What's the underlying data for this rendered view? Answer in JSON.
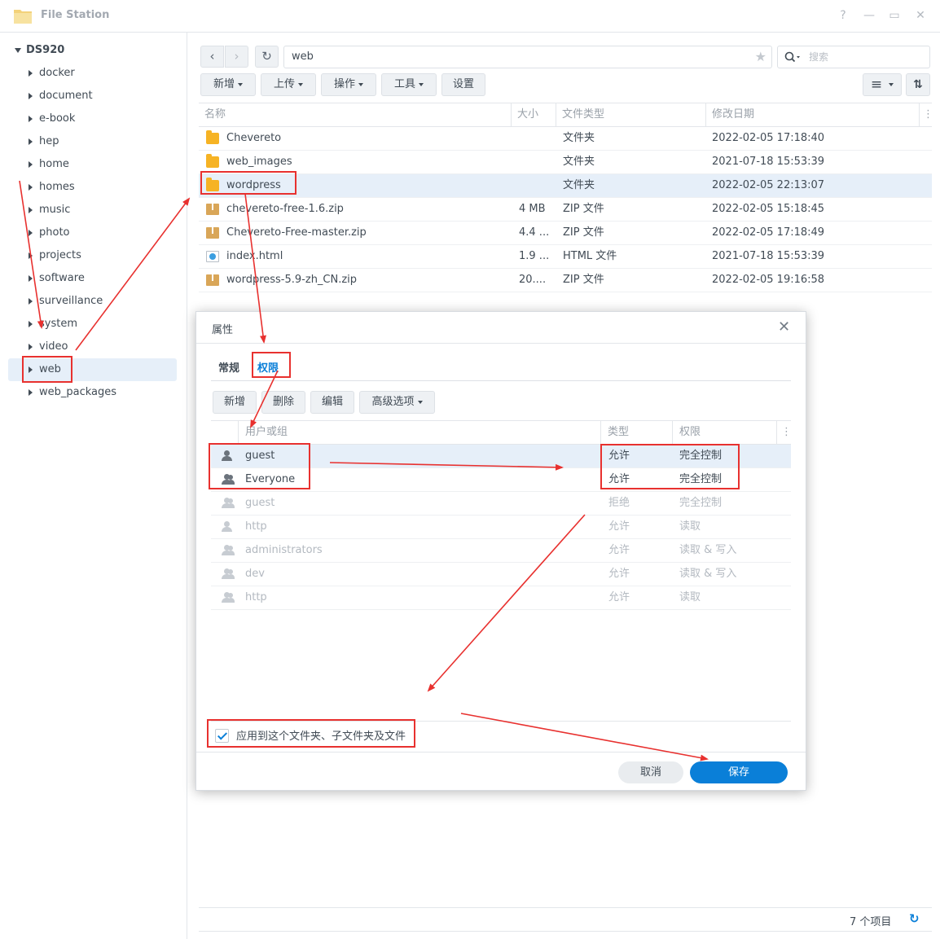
{
  "window": {
    "title": "File Station",
    "help": "?",
    "minimize": "—",
    "maximize": "▭",
    "close": "✕"
  },
  "sidebar": {
    "root": "DS920",
    "items": [
      {
        "label": "docker"
      },
      {
        "label": "document"
      },
      {
        "label": "e-book"
      },
      {
        "label": "hep"
      },
      {
        "label": "home"
      },
      {
        "label": "homes"
      },
      {
        "label": "music"
      },
      {
        "label": "photo"
      },
      {
        "label": "projects"
      },
      {
        "label": "software"
      },
      {
        "label": "surveillance"
      },
      {
        "label": "system"
      },
      {
        "label": "video"
      },
      {
        "label": "web"
      },
      {
        "label": "web_packages"
      }
    ]
  },
  "toolbar": {
    "back": "‹",
    "forward": "›",
    "refresh": "↻",
    "path": "web",
    "star": "★",
    "search_placeholder": "搜索",
    "search_icon": "search-icon",
    "new": "新增",
    "upload": "上传",
    "action": "操作",
    "tools": "工具",
    "settings": "设置",
    "list_view": "≡",
    "sort": "⇅"
  },
  "file_list": {
    "headers": {
      "name": "名称",
      "size": "大小",
      "type": "文件类型",
      "modified": "修改日期"
    },
    "rows": [
      {
        "icon": "folder-icon",
        "name": "Chevereto",
        "size": "",
        "type": "文件夹",
        "modified": "2022-02-05 17:18:40"
      },
      {
        "icon": "folder-icon",
        "name": "web_images",
        "size": "",
        "type": "文件夹",
        "modified": "2021-07-18 15:53:39"
      },
      {
        "icon": "folder-icon",
        "name": "wordpress",
        "size": "",
        "type": "文件夹",
        "modified": "2022-02-05 22:13:07"
      },
      {
        "icon": "zip-icon",
        "name": "chevereto-free-1.6.zip",
        "size": "4 MB",
        "type": "ZIP 文件",
        "modified": "2022-02-05 15:18:45"
      },
      {
        "icon": "zip-icon",
        "name": "Chevereto-Free-master.zip",
        "size": "4.4 ...",
        "type": "ZIP 文件",
        "modified": "2022-02-05 17:18:49"
      },
      {
        "icon": "html-icon",
        "name": "index.html",
        "size": "1.9 ...",
        "type": "HTML 文件",
        "modified": "2021-07-18 15:53:39"
      },
      {
        "icon": "zip-icon",
        "name": "wordpress-5.9-zh_CN.zip",
        "size": "20....",
        "type": "ZIP 文件",
        "modified": "2022-02-05 19:16:58"
      }
    ],
    "item_count": "7 个项目"
  },
  "dialog": {
    "title": "属性",
    "close": "✕",
    "tabs": {
      "general": "常规",
      "permissions": "权限"
    },
    "buttons": {
      "new": "新增",
      "delete": "删除",
      "edit": "编辑",
      "advanced": "高级选项"
    },
    "headers": {
      "user": "用户或组",
      "type": "类型",
      "permission": "权限"
    },
    "rows": [
      {
        "icon": "user-icon",
        "name": "guest",
        "type": "允许",
        "permission": "完全控制"
      },
      {
        "icon": "group-icon",
        "name": "Everyone",
        "type": "允许",
        "permission": "完全控制"
      },
      {
        "icon": "group-icon",
        "name": "guest",
        "type": "拒绝",
        "permission": "完全控制"
      },
      {
        "icon": "user-icon",
        "name": "http",
        "type": "允许",
        "permission": "读取"
      },
      {
        "icon": "group-icon",
        "name": "administrators",
        "type": "允许",
        "permission": "读取 & 写入"
      },
      {
        "icon": "group-icon",
        "name": "dev",
        "type": "允许",
        "permission": "读取 & 写入"
      },
      {
        "icon": "group-icon",
        "name": "http",
        "type": "允许",
        "permission": "读取"
      }
    ],
    "apply_label": "应用到这个文件夹、子文件夹及文件",
    "cancel": "取消",
    "save": "保存"
  },
  "colors": {
    "accent": "#0a7fd8",
    "annotation": "#e8312f",
    "selection": "#e6eff9"
  }
}
